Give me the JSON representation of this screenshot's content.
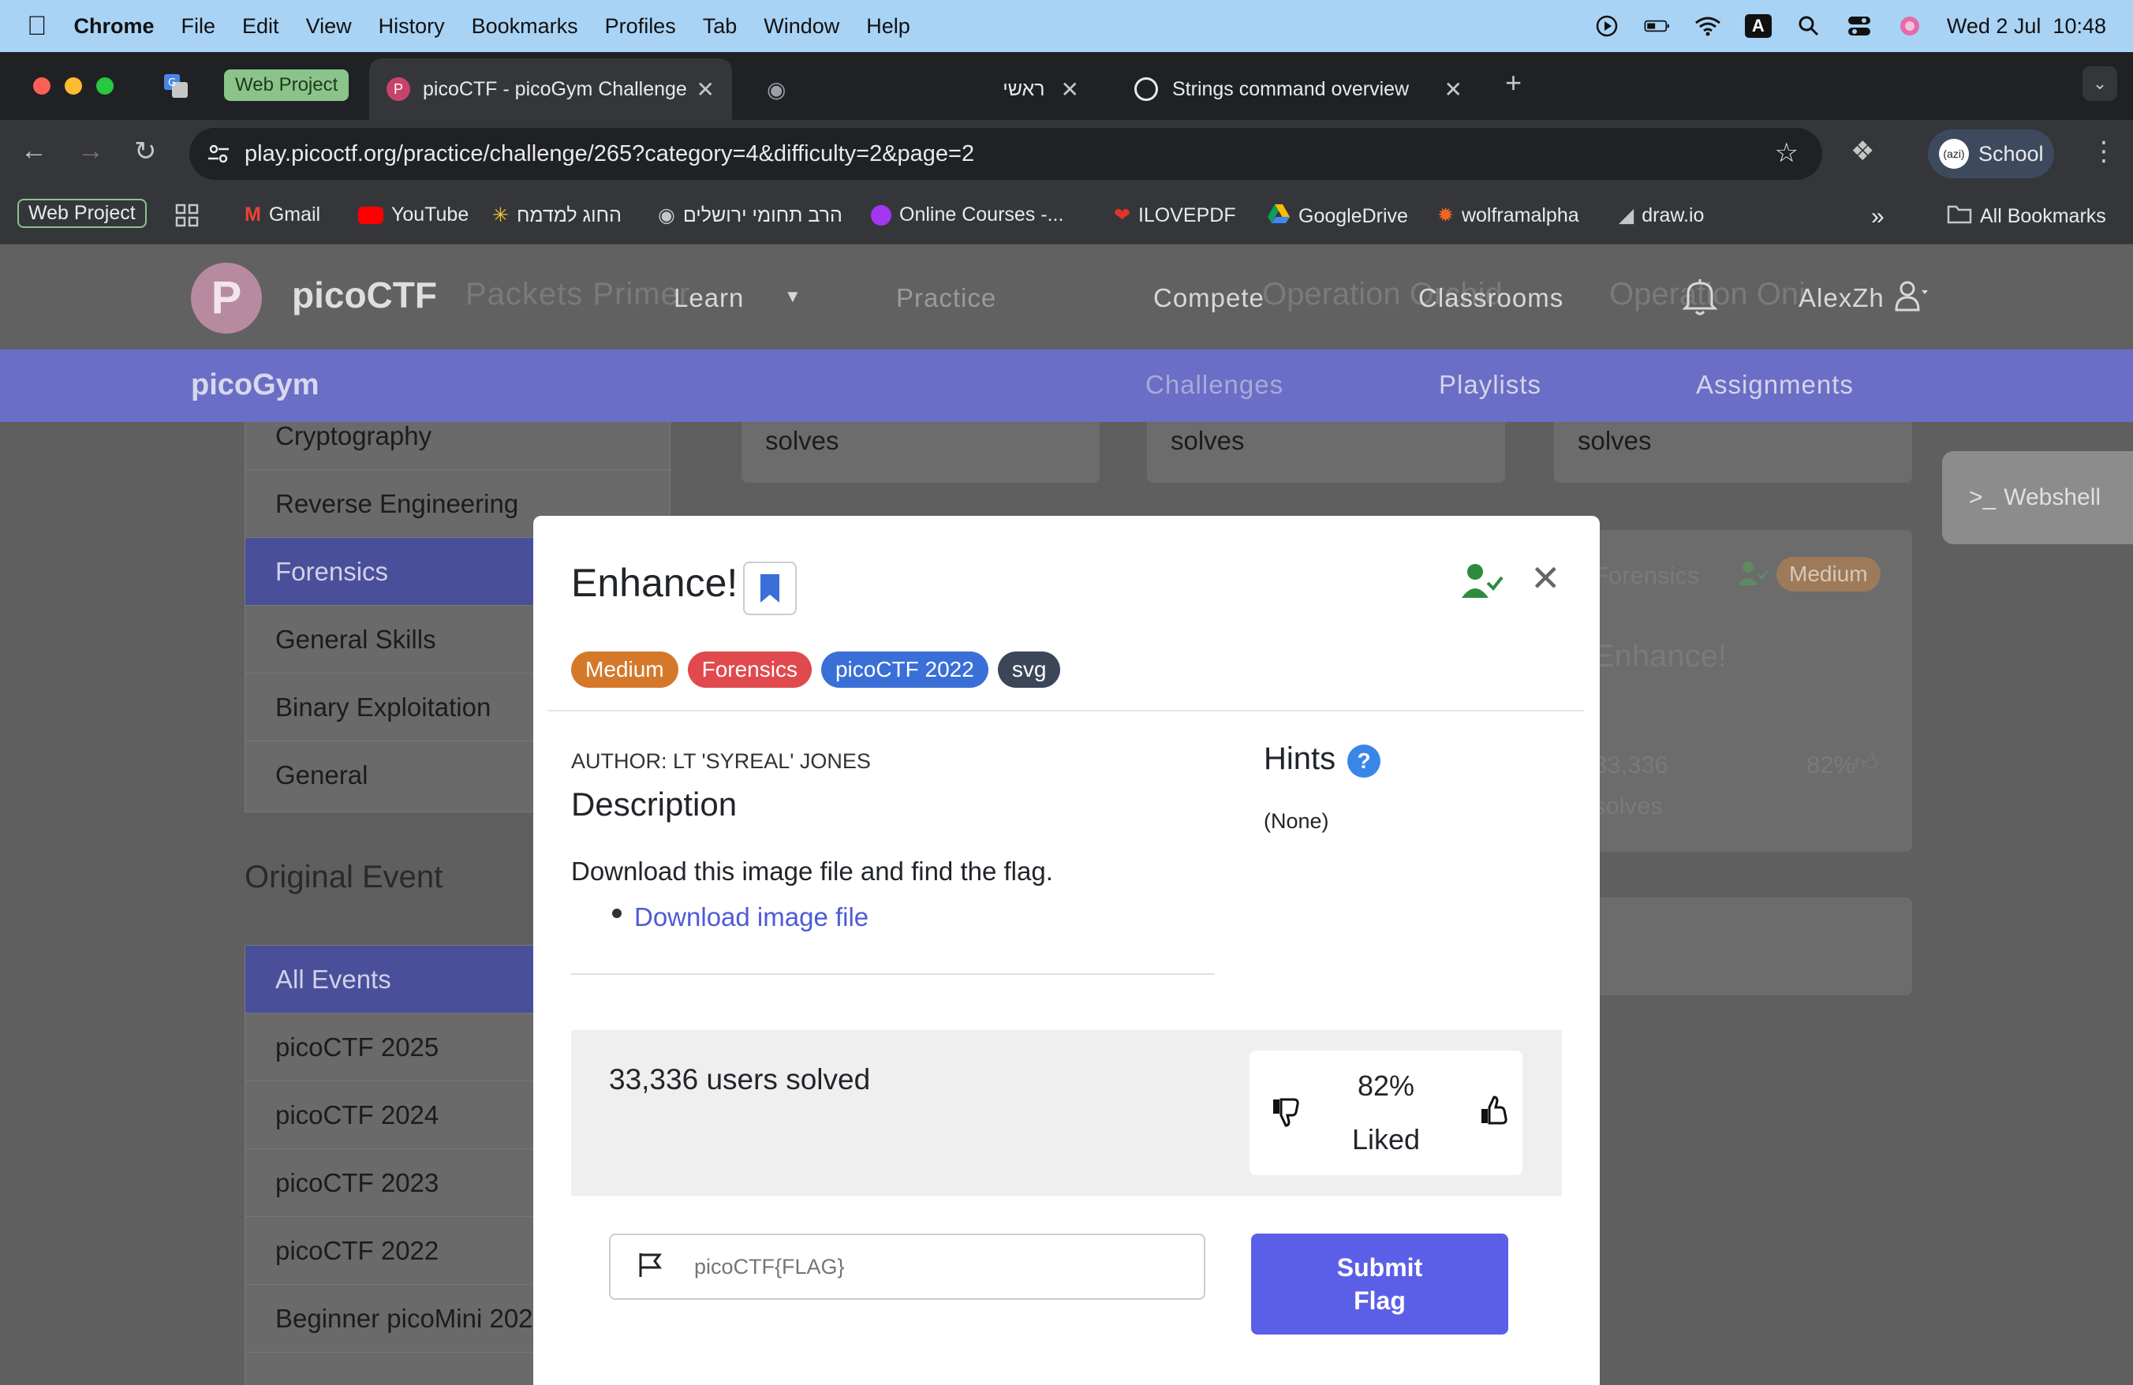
{
  "menubar": {
    "app": "Chrome",
    "items": [
      "File",
      "Edit",
      "View",
      "History",
      "Bookmarks",
      "Profiles",
      "Tab",
      "Window",
      "Help"
    ],
    "clock": "Wed 2 Jul  10:48",
    "input_source": "A"
  },
  "tabs": {
    "group_label": "Web Project",
    "items": [
      {
        "label": "picoCTF - picoGym Challenge"
      },
      {
        "label": "ראשי"
      },
      {
        "label": "Strings command overview"
      }
    ]
  },
  "toolbar": {
    "url": "play.picoctf.org/practice/challenge/265?category=4&difficulty=2&page=2",
    "profile_label": "School",
    "profile_avatar": "(azi)"
  },
  "bookmarks": {
    "group_label": "Web Project",
    "items": [
      "Gmail",
      "YouTube",
      "החוג למדמח",
      "הרב תחומי ירושלים",
      "Online Courses -...",
      "ILOVEPDF",
      "GoogleDrive",
      "wolframalpha",
      "draw.io"
    ],
    "all_label": "All Bookmarks"
  },
  "site": {
    "logo": "picoCTF",
    "logo_letter": "P",
    "nav": [
      "Learn",
      "Practice",
      "Compete",
      "Classrooms"
    ],
    "user": "AlexZh",
    "subnav_brand": "picoGym",
    "subnav": [
      "Challenges",
      "Playlists",
      "Assignments"
    ],
    "webshell": "Webshell"
  },
  "background": {
    "categories": [
      "Cryptography",
      "Reverse Engineering",
      "Forensics",
      "General Skills",
      "Binary Exploitation",
      "General"
    ],
    "original_event_title": "Original Event",
    "events": [
      "All Events",
      "picoCTF 2025",
      "picoCTF 2024",
      "picoCTF 2023",
      "picoCTF 2022",
      "Beginner picoMini 202"
    ],
    "top_cards": [
      "Packets Primer",
      "Operation Orchid",
      "Operation Oni"
    ],
    "solves_label": "solves",
    "card": {
      "category": "Forensics",
      "difficulty": "Medium",
      "title": "Enhance!",
      "solves": "33,336",
      "solves_label": "solves",
      "liked": "82%"
    }
  },
  "modal": {
    "title": "Enhance!",
    "tags": [
      {
        "label": "Medium",
        "color": "#d4792a"
      },
      {
        "label": "Forensics",
        "color": "#e0494d"
      },
      {
        "label": "picoCTF 2022",
        "color": "#3a6fd8"
      },
      {
        "label": "svg",
        "color": "#3c4659"
      }
    ],
    "author": "AUTHOR: LT 'SYREAL' JONES",
    "description_heading": "Description",
    "description": "Download this image file and find the flag.",
    "download_link": "Download image file",
    "hints_heading": "Hints",
    "hints_value": "(None)",
    "solved_count": "33,336 users solved",
    "liked_pct": "82%",
    "liked_label": "Liked",
    "flag_placeholder": "picoCTF{FLAG}",
    "submit_label": "Submit Flag"
  },
  "colors": {
    "accent": "#5b5fe8",
    "link": "#4d5bd6",
    "solved_green": "#2e8b3e"
  }
}
